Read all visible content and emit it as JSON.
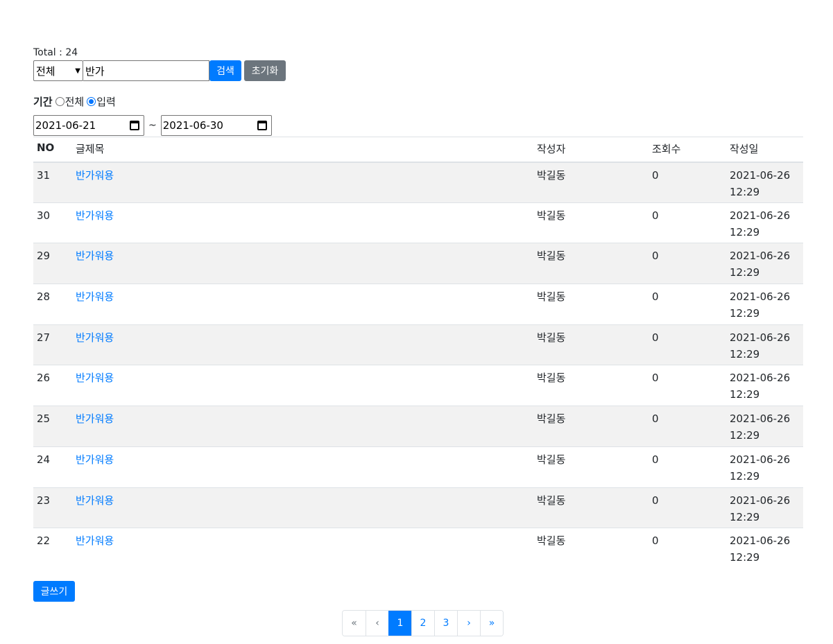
{
  "total_label": "Total : 24",
  "search": {
    "category_selected": "전체",
    "keyword_value": "반가",
    "search_button": "검색",
    "reset_button": "초기화"
  },
  "period": {
    "label": "기간",
    "option_all": "전체",
    "option_input": "입력",
    "selected": "입력",
    "start_date": "2021-06-21",
    "separator": "~",
    "end_date": "2021-06-30"
  },
  "table": {
    "headers": [
      "NO",
      "글제목",
      "작성자",
      "조회수",
      "작성일"
    ],
    "rows": [
      {
        "no": "31",
        "title": "반가워용",
        "author": "박길동",
        "views": "0",
        "date": "2021-06-26",
        "time": "12:29"
      },
      {
        "no": "30",
        "title": "반가워용",
        "author": "박길동",
        "views": "0",
        "date": "2021-06-26",
        "time": "12:29"
      },
      {
        "no": "29",
        "title": "반가워용",
        "author": "박길동",
        "views": "0",
        "date": "2021-06-26",
        "time": "12:29"
      },
      {
        "no": "28",
        "title": "반가워용",
        "author": "박길동",
        "views": "0",
        "date": "2021-06-26",
        "time": "12:29"
      },
      {
        "no": "27",
        "title": "반가워용",
        "author": "박길동",
        "views": "0",
        "date": "2021-06-26",
        "time": "12:29"
      },
      {
        "no": "26",
        "title": "반가워용",
        "author": "박길동",
        "views": "0",
        "date": "2021-06-26",
        "time": "12:29"
      },
      {
        "no": "25",
        "title": "반가워용",
        "author": "박길동",
        "views": "0",
        "date": "2021-06-26",
        "time": "12:29"
      },
      {
        "no": "24",
        "title": "반가워용",
        "author": "박길동",
        "views": "0",
        "date": "2021-06-26",
        "time": "12:29"
      },
      {
        "no": "23",
        "title": "반가워용",
        "author": "박길동",
        "views": "0",
        "date": "2021-06-26",
        "time": "12:29"
      },
      {
        "no": "22",
        "title": "반가워용",
        "author": "박길동",
        "views": "0",
        "date": "2021-06-26",
        "time": "12:29"
      }
    ]
  },
  "write_button": "글쓰기",
  "pagination": {
    "first": "«",
    "prev": "‹",
    "pages": [
      "1",
      "2",
      "3"
    ],
    "current": "1",
    "next": "›",
    "last": "»"
  }
}
